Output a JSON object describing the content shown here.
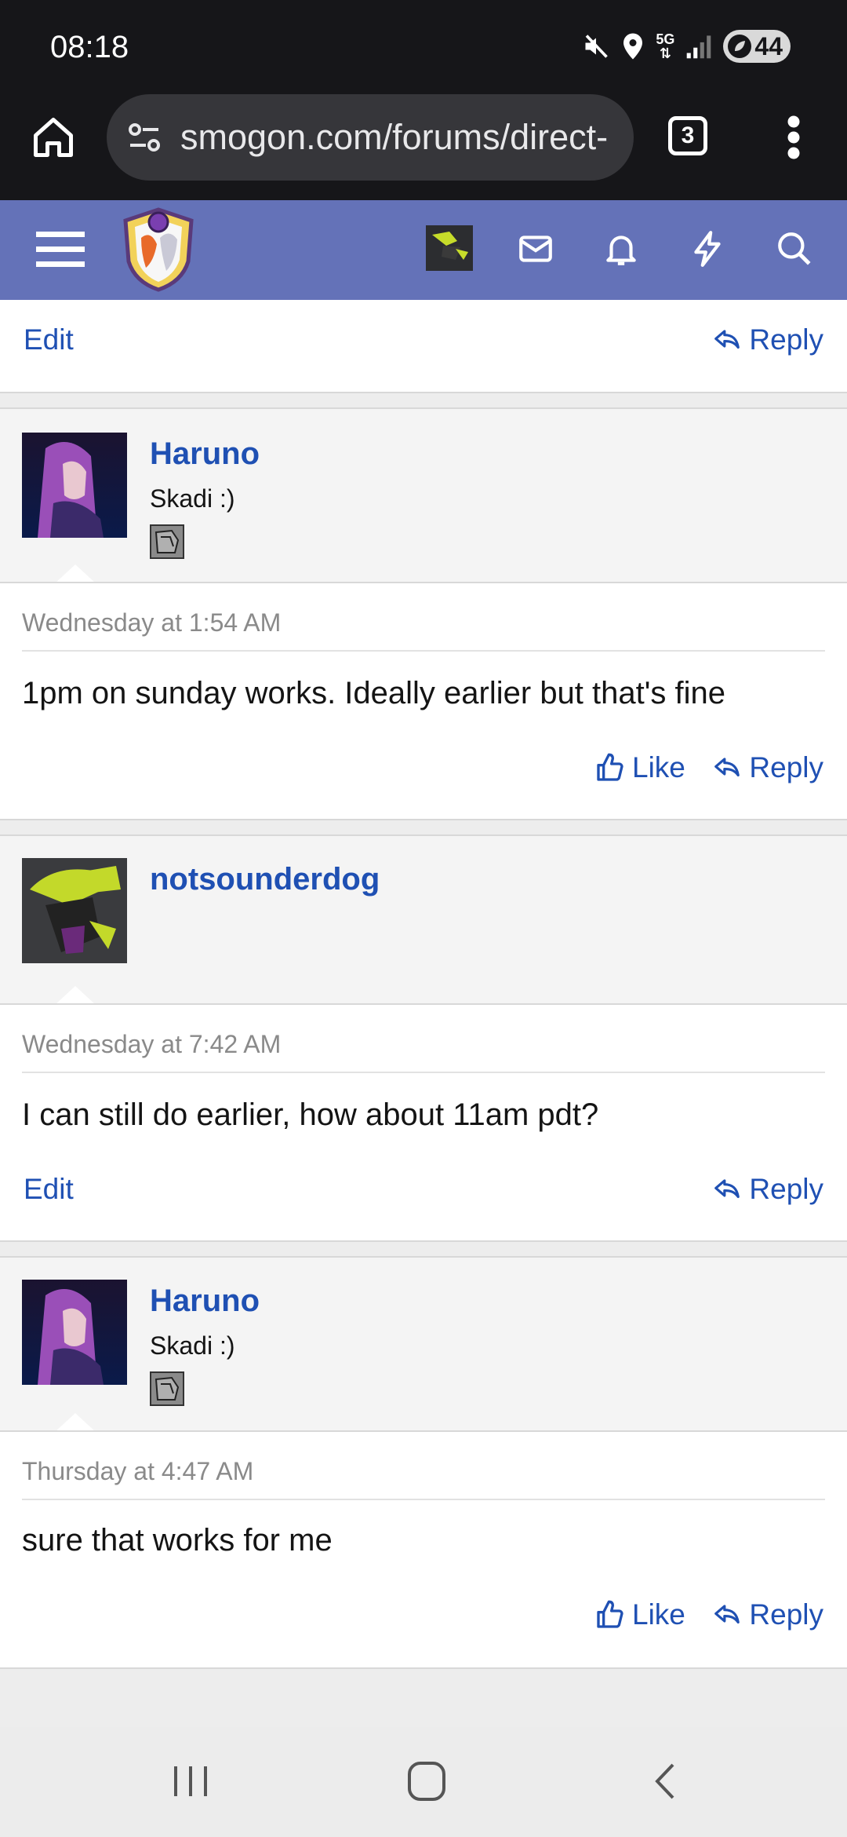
{
  "status_bar": {
    "time": "08:18",
    "network": "5G",
    "battery": "44"
  },
  "browser": {
    "url": "smogon.com/forums/direct-",
    "tab_count": "3"
  },
  "top_actions": {
    "edit_label": "Edit",
    "reply_label": "Reply"
  },
  "posts": [
    {
      "username": "Haruno",
      "user_title": "Skadi :)",
      "timestamp": "Wednesday at 1:54 AM",
      "message": "1pm on sunday works. Ideally earlier but that's fine",
      "like_label": "Like",
      "reply_label": "Reply"
    },
    {
      "username": "notsounderdog",
      "timestamp": "Wednesday at 7:42 AM",
      "message": "I can still do earlier, how about 11am pdt?",
      "edit_label": "Edit",
      "reply_label": "Reply"
    },
    {
      "username": "Haruno",
      "user_title": "Skadi :)",
      "timestamp": "Thursday at 4:47 AM",
      "message": "sure that works for me",
      "like_label": "Like",
      "reply_label": "Reply"
    }
  ],
  "colors": {
    "header": "#6472b8",
    "link": "#1f50b3",
    "browser_chrome": "#161619"
  }
}
